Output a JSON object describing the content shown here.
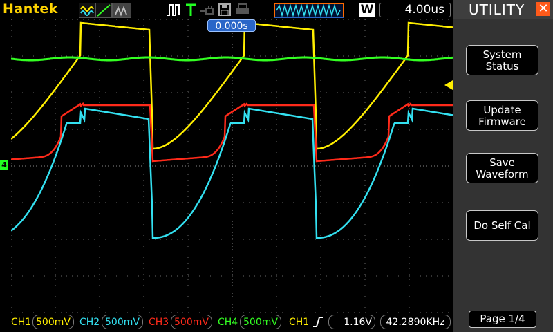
{
  "header": {
    "brand": "Hantek",
    "timebase": "4.00us",
    "window_mode_label": "W",
    "trigger_time": "0.000s"
  },
  "icons": [
    "waveform-icon",
    "ramp-icon",
    "gray-icon",
    "pulse-icon",
    "trigger-t-icon",
    "probe-icon",
    "save-icon",
    "print-icon"
  ],
  "channels": [
    {
      "label": "CH1",
      "scale": "500mV",
      "color": "#ffee00"
    },
    {
      "label": "CH2",
      "scale": "500mV",
      "color": "#33e0f0"
    },
    {
      "label": "CH3",
      "scale": "500mV",
      "color": "#ff2a1a"
    },
    {
      "label": "CH4",
      "scale": "500mV",
      "color": "#33ff22"
    }
  ],
  "trigger": {
    "source": "CH1",
    "level": "1.16V",
    "frequency": "42.2890KHz"
  },
  "side_marker": "4",
  "panel": {
    "title": "UTILITY",
    "buttons": [
      {
        "line1": "System",
        "line2": "Status"
      },
      {
        "line1": "Update",
        "line2": "Firmware"
      },
      {
        "line1": "Save",
        "line2": "Waveform"
      },
      {
        "line1": "Do Self Cal",
        "line2": ""
      }
    ],
    "page": "Page 1/4"
  }
}
